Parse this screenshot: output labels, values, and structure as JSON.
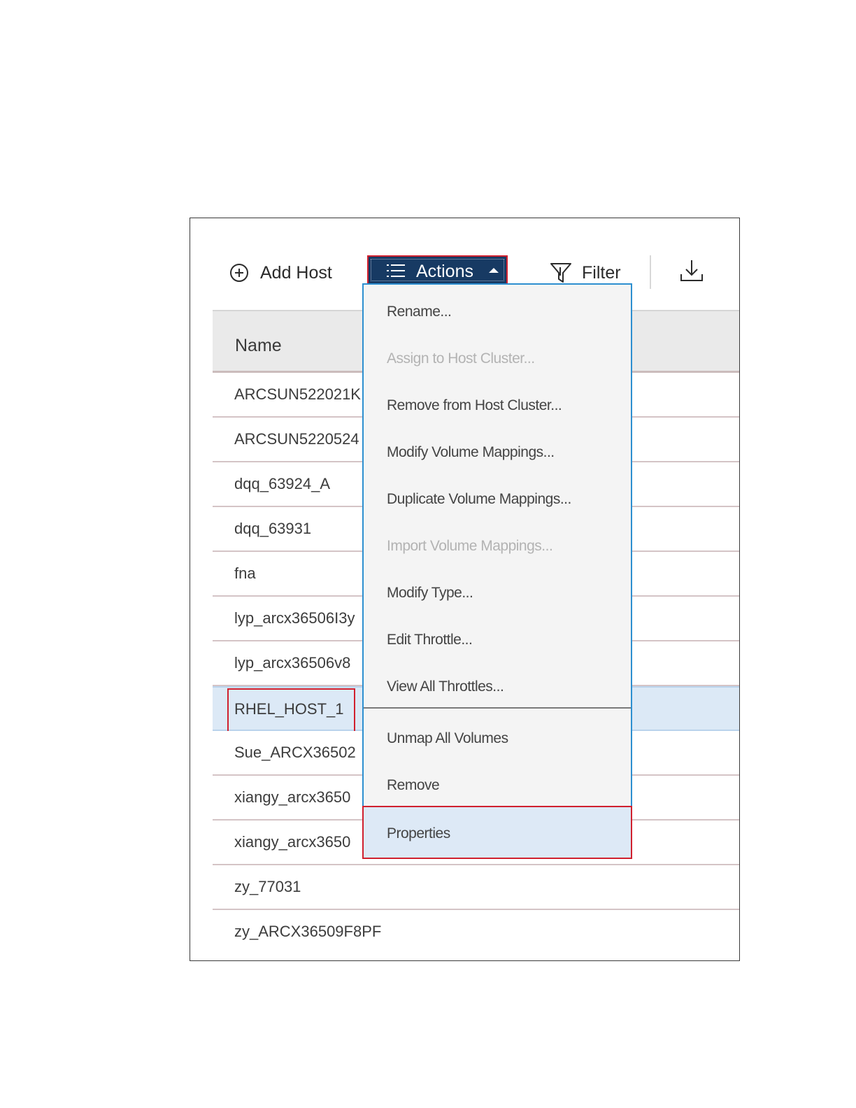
{
  "toolbar": {
    "add_host_label": "Add Host",
    "actions_label": "Actions",
    "filter_label": "Filter"
  },
  "table": {
    "header_name": "Name",
    "rows": [
      "ARCSUN522021K",
      "ARCSUN5220524",
      "dqq_63924_A",
      "dqq_63931",
      "fna",
      "lyp_arcx36506I3y",
      "lyp_arcx36506v8",
      "RHEL_HOST_1",
      "Sue_ARCX36502",
      "xiangy_arcx3650",
      "xiangy_arcx3650",
      "zy_77031",
      "zy_ARCX36509F8PF"
    ],
    "selected_row": "RHEL_HOST_1"
  },
  "menu": {
    "items": [
      {
        "label": "Rename...",
        "enabled": true
      },
      {
        "label": "Assign to Host Cluster...",
        "enabled": false
      },
      {
        "label": "Remove from Host Cluster...",
        "enabled": true
      },
      {
        "label": "Modify Volume Mappings...",
        "enabled": true
      },
      {
        "label": "Duplicate Volume Mappings...",
        "enabled": true
      },
      {
        "label": "Import Volume Mappings...",
        "enabled": false
      },
      {
        "label": "Modify Type...",
        "enabled": true
      },
      {
        "label": "Edit Throttle...",
        "enabled": true
      },
      {
        "label": "View All Throttles...",
        "enabled": true
      },
      {
        "label": "Unmap All Volumes",
        "enabled": true
      },
      {
        "label": "Remove",
        "enabled": true
      },
      {
        "label": "Properties",
        "enabled": true
      }
    ],
    "highlighted": "Properties"
  },
  "colors": {
    "actions_bg": "#173a63",
    "highlight_border": "#d0202e",
    "menu_border": "#2d8fd0",
    "selected_row_bg": "#dce9f6"
  }
}
